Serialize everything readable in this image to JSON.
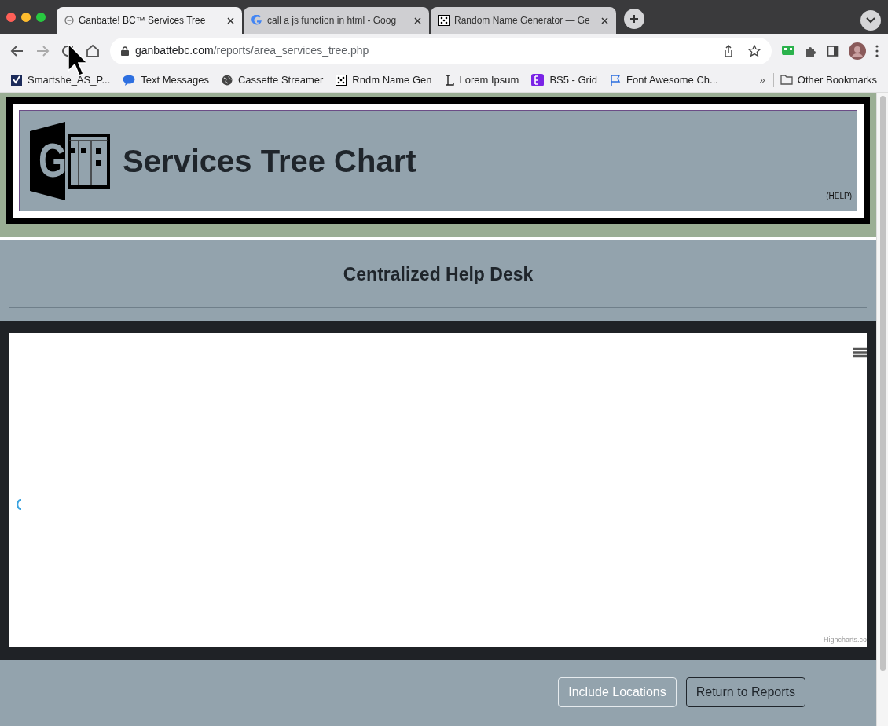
{
  "browser": {
    "tabs": [
      {
        "title": "Ganbatte! BC™ Services Tree",
        "selected": true
      },
      {
        "title": "call a js function in html - Goog",
        "selected": false
      },
      {
        "title": "Random Name Generator — Ge",
        "selected": false
      }
    ],
    "address": {
      "host": "ganbattebc.com",
      "path": "/reports/area_services_tree.php"
    },
    "bookmarks": [
      "Smartshe_AS_P...",
      "Text Messages",
      "Cassette Streamer",
      "Rndm Name Gen",
      "Lorem Ipsum",
      "BS5 - Grid",
      "Font Awesome Ch..."
    ],
    "more": "»",
    "other_bookmarks": "Other Bookmarks"
  },
  "header": {
    "logo_letter": "G",
    "title": "Services Tree Chart",
    "help_link": "(HELP)"
  },
  "section_title": "Centralized Help Desk",
  "chart": {
    "credit": "Highcharts.co"
  },
  "buttons": [
    {
      "label": "Include Locations",
      "kind": "outline-light"
    },
    {
      "label": "Return to Reports",
      "kind": "outline-dark"
    }
  ]
}
